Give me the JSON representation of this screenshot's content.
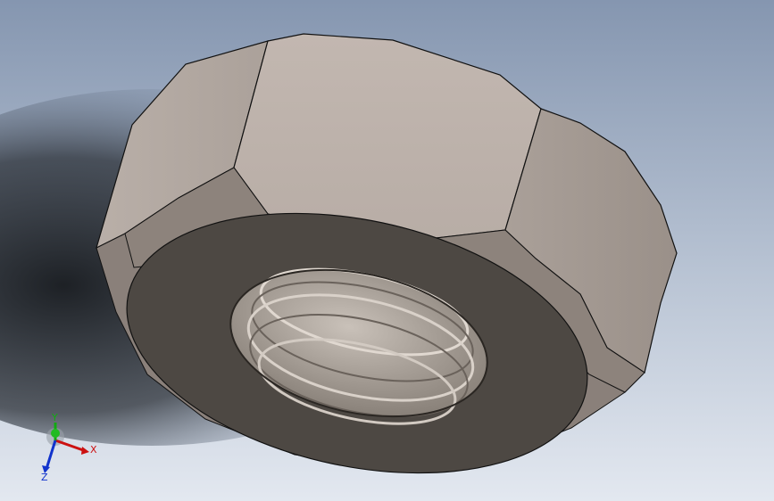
{
  "viewport": {
    "background_top": "#8b9bb3",
    "background_bottom": "#dfe5ee",
    "shadow_color": "#1a1d22"
  },
  "model": {
    "face_light": "#bdb2ab",
    "face_mid": "#a89e97",
    "face_dark": "#8d837c",
    "washer_face": "#4b4641",
    "thread_light": "#c8c0b8",
    "thread_dark": "#6e6760",
    "edge_color": "#111111"
  },
  "triad": {
    "x_label": "X",
    "y_label": "Y",
    "z_label": "Z",
    "x_color": "#cc1111",
    "y_color": "#11aa11",
    "z_color": "#1133cc"
  }
}
